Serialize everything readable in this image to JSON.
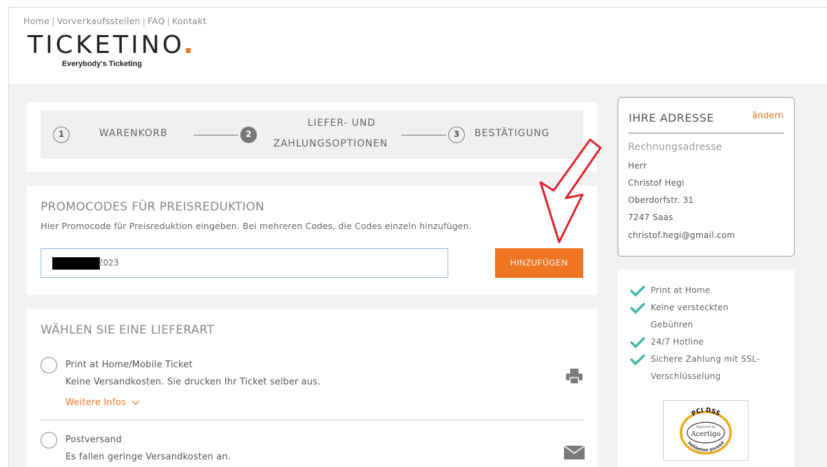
{
  "topnav": {
    "items": [
      "Home",
      "Vorverkaufsstellen",
      "FAQ",
      "Kontakt"
    ]
  },
  "logo": {
    "name": "TICKETINO",
    "tagline": "Everybody's Ticketing"
  },
  "steps": [
    {
      "number": "1",
      "label": "WARENKORB"
    },
    {
      "number": "2",
      "label_line1": "LIEFER- UND",
      "label_line2": "ZAHLUNGSOPTIONEN"
    },
    {
      "number": "3",
      "label": "BESTÄTIGUNG"
    }
  ],
  "promo": {
    "title": "PROMOCODES FÜR PREISREDUKTION",
    "description": "Hier Promocode für Preisreduktion eingeben. Bei mehreren Codes, die Codes einzeln hinzufügen.",
    "input_value_visible": "2023",
    "button_label": "HINZUFÜGEN"
  },
  "delivery": {
    "title": "WÄHLEN SIE EINE LIEFERART",
    "options": [
      {
        "title": "Print at Home/Mobile Ticket",
        "description": "Keine Versandkosten. Sie drucken Ihr Ticket selber aus.",
        "more_info": "Weitere Infos",
        "icon": "printer-icon"
      },
      {
        "title": "Postversand",
        "description": "Es fallen geringe Versandkosten an.",
        "icon": "envelope-icon"
      }
    ]
  },
  "address": {
    "title": "IHRE ADRESSE",
    "edit_label": "ändern",
    "subtitle": "Rechnungsadresse",
    "lines": [
      "Herr",
      "Christof Hegi",
      "Oberdorfstr. 31",
      "7247 Saas",
      "christof.hegi@gmail.com"
    ]
  },
  "trust": {
    "items": [
      "Print at Home",
      "Keine versteckten",
      "Gebühren",
      "24/7 Hotline",
      "Sichere Zahlung mit SSL-",
      "Verschlüsselung"
    ],
    "badge": {
      "top": "PCI DSS",
      "middle": "Acertigo",
      "bottom": "Validation passed",
      "small": "Approved by"
    }
  },
  "colors": {
    "accent": "#ee7623",
    "check": "#3fb6a4",
    "annotation_arrow": "#e0202a"
  }
}
